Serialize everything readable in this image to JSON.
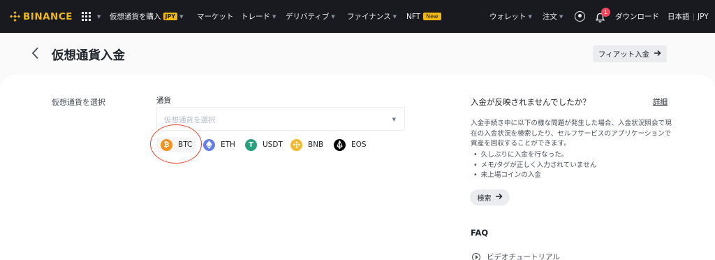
{
  "nav": {
    "logo_text": "BINANCE",
    "buy_crypto": "仮想通貨を購入",
    "buy_crypto_badge": "JPY",
    "markets": "マーケット",
    "trade": "トレード",
    "derivatives": "デリバティブ",
    "finance": "ファイナンス",
    "nft": "NFT",
    "nft_badge": "New",
    "wallet": "ウォレット",
    "orders": "注文",
    "notification_count": "1",
    "download": "ダウンロード",
    "language": "日本語",
    "currency": "JPY"
  },
  "page": {
    "title": "仮想通貨入金",
    "fiat_button": "フィアット入金"
  },
  "form": {
    "select_label": "仮想通貨を選択",
    "currency_label": "通貨",
    "select_placeholder": "仮想通貨を選択",
    "coins": [
      {
        "symbol": "BTC",
        "color": "#f7931a"
      },
      {
        "symbol": "ETH",
        "color": "#627eea"
      },
      {
        "symbol": "USDT",
        "color": "#26a17b"
      },
      {
        "symbol": "BNB",
        "color": "#f3ba2f"
      },
      {
        "symbol": "EOS",
        "color": "#000000"
      }
    ]
  },
  "help": {
    "title": "入金が反映されませんでしたか？",
    "details_link": "詳細",
    "description": "入金手続き中に以下の様な問題が発生した場合、入金状況照会で現在の入金状況を検索したり、セルフサービスのアプリケーションで資産を回収することができます。",
    "items": [
      "久しぶりに入金を行なった。",
      "メモ/タグが正しく入力されていません",
      "未上場コインの入金"
    ],
    "search_button": "検索"
  },
  "faq": {
    "title": "FAQ",
    "items": [
      "ビデオチュートリアル"
    ]
  }
}
